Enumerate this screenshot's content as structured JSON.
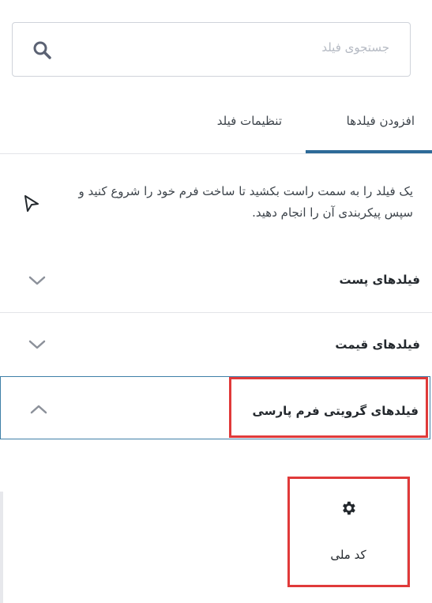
{
  "search": {
    "placeholder": "جستجوی فیلد",
    "icon": "search-icon"
  },
  "tabs": [
    {
      "label": "افزودن فیلدها",
      "active": true
    },
    {
      "label": "تنظیمات فیلد",
      "active": false
    }
  ],
  "hint": {
    "text": "یک فیلد را به سمت راست بکشید تا ساخت فرم خود را شروع کنید و سپس پیکربندی آن را انجام دهید.",
    "icon": "pointer-icon"
  },
  "sections": [
    {
      "title": "فیلدهای پست",
      "expanded": false
    },
    {
      "title": "فیلدهای قیمت",
      "expanded": false
    },
    {
      "title": "فیلدهای گرویتی فرم پارسی",
      "expanded": true
    }
  ],
  "field_buttons": [
    {
      "label": "کد ملی",
      "icon": "gear-icon"
    }
  ],
  "colors": {
    "accent": "#2d6a98",
    "highlight": "#e03a3a",
    "border": "#cfd3da"
  }
}
